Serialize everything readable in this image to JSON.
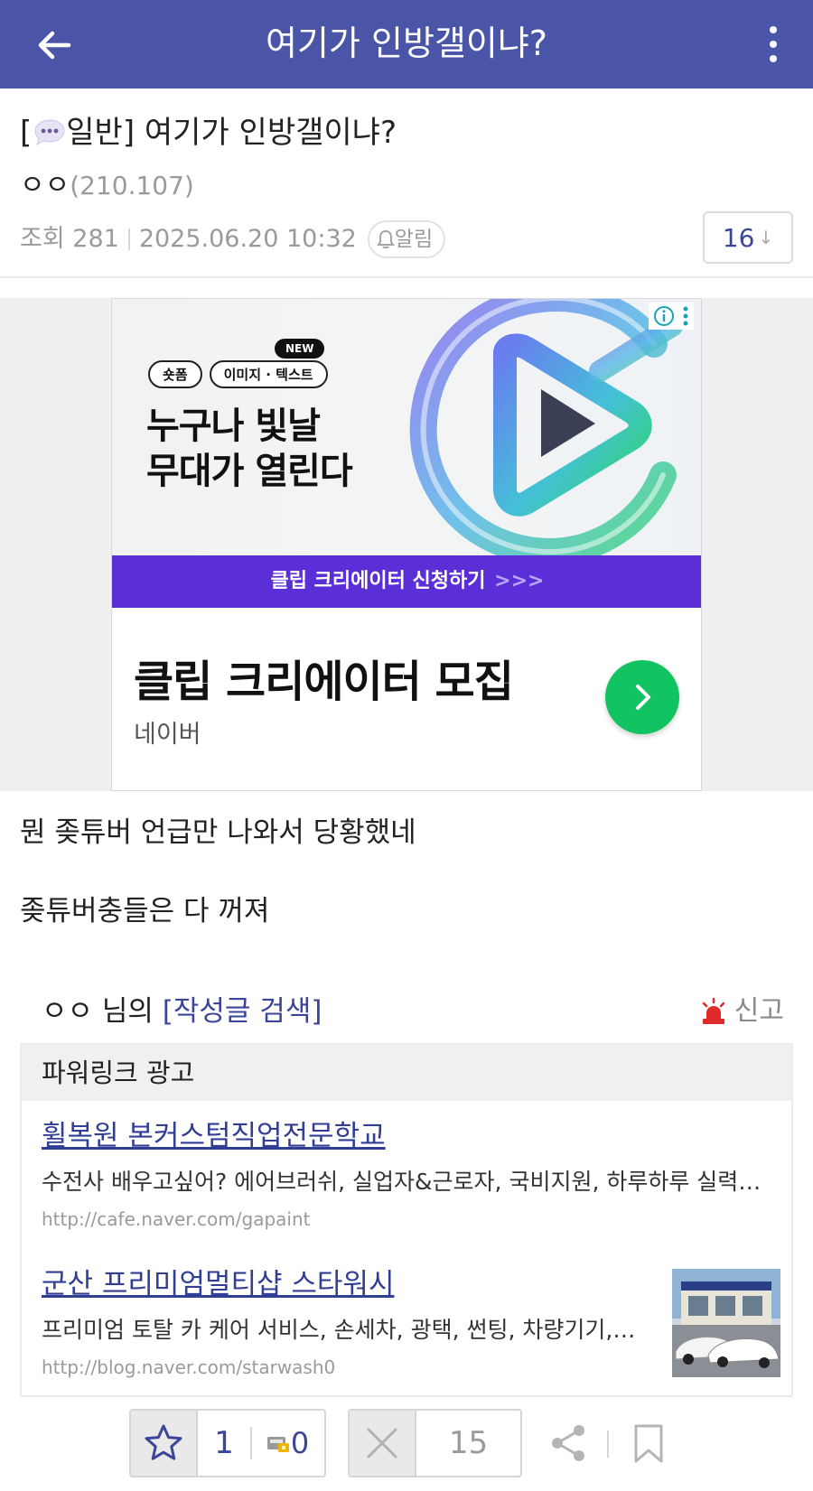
{
  "header": {
    "title": "여기가 인방갤이냐?"
  },
  "post": {
    "category_open": "[",
    "category": "일반]",
    "title": "여기가 인방갤이냐?",
    "author": "ㅇㅇ",
    "author_ip": "(210.107)",
    "views_label": "조회 281",
    "datetime": "2025.06.20 10:32",
    "alarm_label": "알림",
    "comment_count": "16",
    "comment_arrow": "↓"
  },
  "ad": {
    "tag1": "숏폼",
    "tag2": "이미지 · 텍스트",
    "new_badge": "NEW",
    "headline_line1": "누구나 빛날",
    "headline_line2": "무대가 열린다",
    "strip_text": "클립 크리에이터 신청하기",
    "strip_chevrons": ">>>",
    "title": "클립 크리에이터 모집",
    "source": "네이버",
    "accent_color": "#5b2fd8",
    "go_color": "#12c461"
  },
  "content": {
    "line1": "뭔 좆튜버 언급만 나와서 당황했네",
    "line2": "좆튜버충들은 다 꺼져"
  },
  "writer": {
    "name": "ㅇㅇ",
    "suffix": " 님의 ",
    "search_link": "[작성글 검색]",
    "report_label": "신고"
  },
  "powerlink": {
    "heading": "파워링크 광고",
    "items": [
      {
        "title": "휠복원 본커스텀직업전문학교",
        "desc": "수전사 배우고싶어? 에어브러쉬, 실업자&근로자, 국비지원, 하루하루 실력이 느는 곳",
        "url": "http://cafe.naver.com/gapaint"
      },
      {
        "title": "군산 프리미엄멀티샵 스타워시",
        "desc": "프리미엄 토탈 카 케어 서비스, 손세차, 광택, 썬팅, 차량기기, 디테일링",
        "url": "http://blog.naver.com/starwash0"
      }
    ]
  },
  "actions": {
    "recommend_count": "1",
    "fixed_recommend_count": "0",
    "downvote_count": "15"
  }
}
